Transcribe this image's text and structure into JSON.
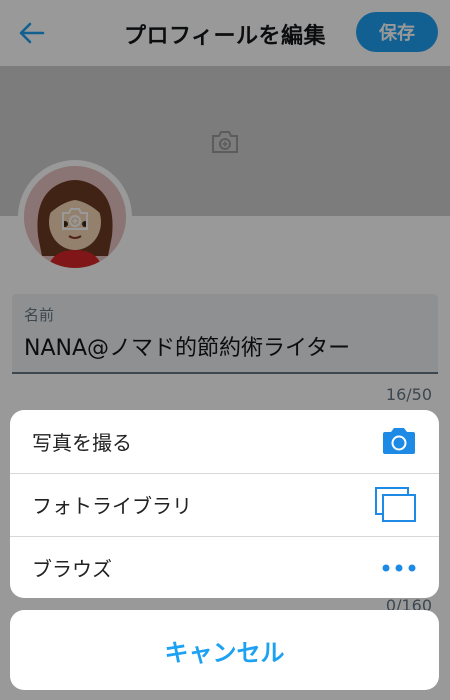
{
  "header": {
    "title": "プロフィールを編集",
    "save_label": "保存"
  },
  "profile": {
    "name_label": "名前",
    "name_value": "NANA@ノマド的節約術ライター",
    "name_counter": "16/50",
    "bio_counter": "0/160"
  },
  "action_sheet": {
    "items": [
      {
        "label": "写真を撮る",
        "icon": "camera-icon"
      },
      {
        "label": "フォトライブラリ",
        "icon": "photo-library-icon"
      },
      {
        "label": "ブラウズ",
        "icon": "more-icon"
      }
    ],
    "cancel_label": "キャンセル"
  },
  "colors": {
    "accent": "#1da1f2",
    "text": "#14171a",
    "muted": "#657786"
  }
}
